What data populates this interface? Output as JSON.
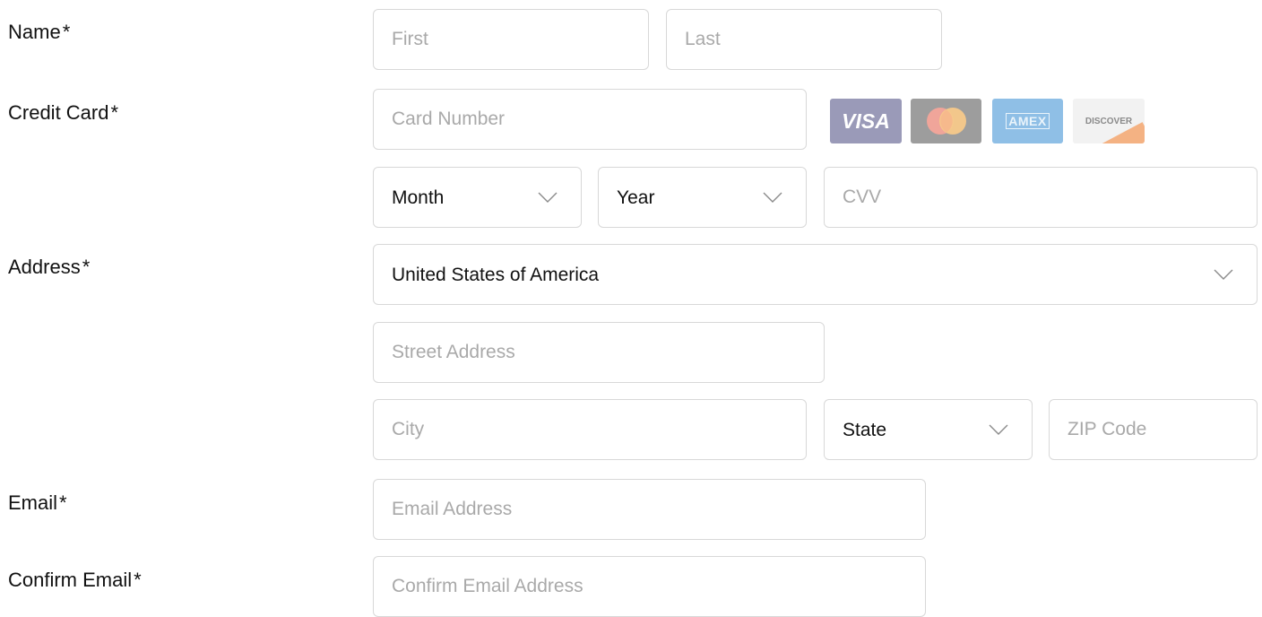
{
  "labels": {
    "name": "Name",
    "credit_card": "Credit Card",
    "address": "Address",
    "email": "Email",
    "confirm_email": "Confirm Email",
    "required_marker": "*"
  },
  "fields": {
    "first_placeholder": "First",
    "last_placeholder": "Last",
    "card_number_placeholder": "Card Number",
    "month_value": "Month",
    "year_value": "Year",
    "cvv_placeholder": "CVV",
    "country_value": "United States of America",
    "street_placeholder": "Street Address",
    "city_placeholder": "City",
    "state_value": "State",
    "zip_placeholder": "ZIP Code",
    "email_placeholder": "Email Address",
    "confirm_email_placeholder": "Confirm Email Address"
  },
  "card_logos": {
    "visa": "VISA",
    "amex": "AMEX",
    "discover": "DISCOVER",
    "mastercard_icon": "mastercard-icon"
  },
  "colors": {
    "border": "#d8d8d8",
    "placeholder": "#a9a9a9",
    "text": "#111111",
    "visa_bg": "#9a9ab8",
    "mastercard_bg": "#9d9d9d",
    "amex_bg": "#8fbfe6",
    "discover_bg": "#f2f2f2"
  }
}
